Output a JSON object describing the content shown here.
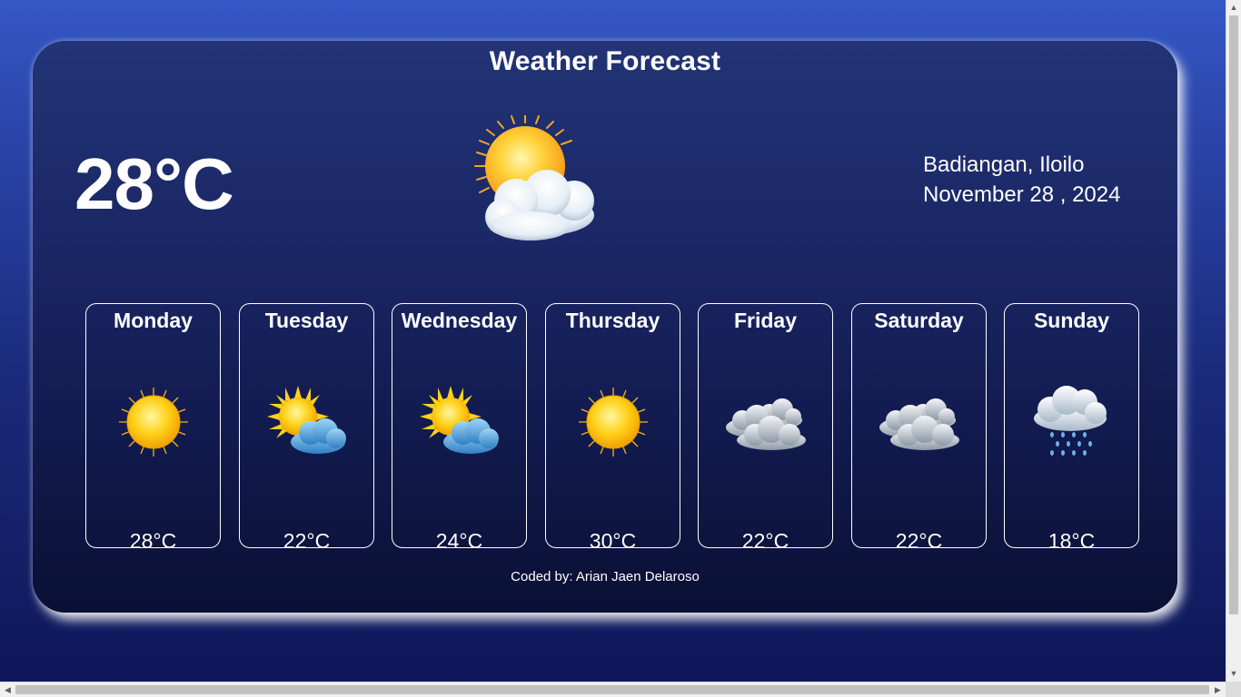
{
  "app": {
    "title": "Weather Forecast"
  },
  "current": {
    "temperature": "28°C",
    "condition_icon": "sun-behind-cloud-icon",
    "location": "Badiangan, Iloilo",
    "date": "November 28 , 2024"
  },
  "forecast": [
    {
      "day": "Monday",
      "temp": "28°C",
      "icon": "sun-icon"
    },
    {
      "day": "Tuesday",
      "temp": "22°C",
      "icon": "sun-behind-cloud-icon"
    },
    {
      "day": "Wednesday",
      "temp": "24°C",
      "icon": "sun-behind-cloud-icon"
    },
    {
      "day": "Thursday",
      "temp": "30°C",
      "icon": "sun-icon"
    },
    {
      "day": "Friday",
      "temp": "22°C",
      "icon": "cloudy-icon"
    },
    {
      "day": "Saturday",
      "temp": "22°C",
      "icon": "cloudy-icon"
    },
    {
      "day": "Sunday",
      "temp": "18°C",
      "icon": "rain-cloud-icon"
    }
  ],
  "footer": {
    "credit": "Coded by: Arian Jaen Delaroso"
  },
  "colors": {
    "background_top": "#3558c6",
    "background_bottom": "#0e1657",
    "card_top": "#223476",
    "card_bottom": "#0a1034",
    "text": "#ffffff"
  }
}
